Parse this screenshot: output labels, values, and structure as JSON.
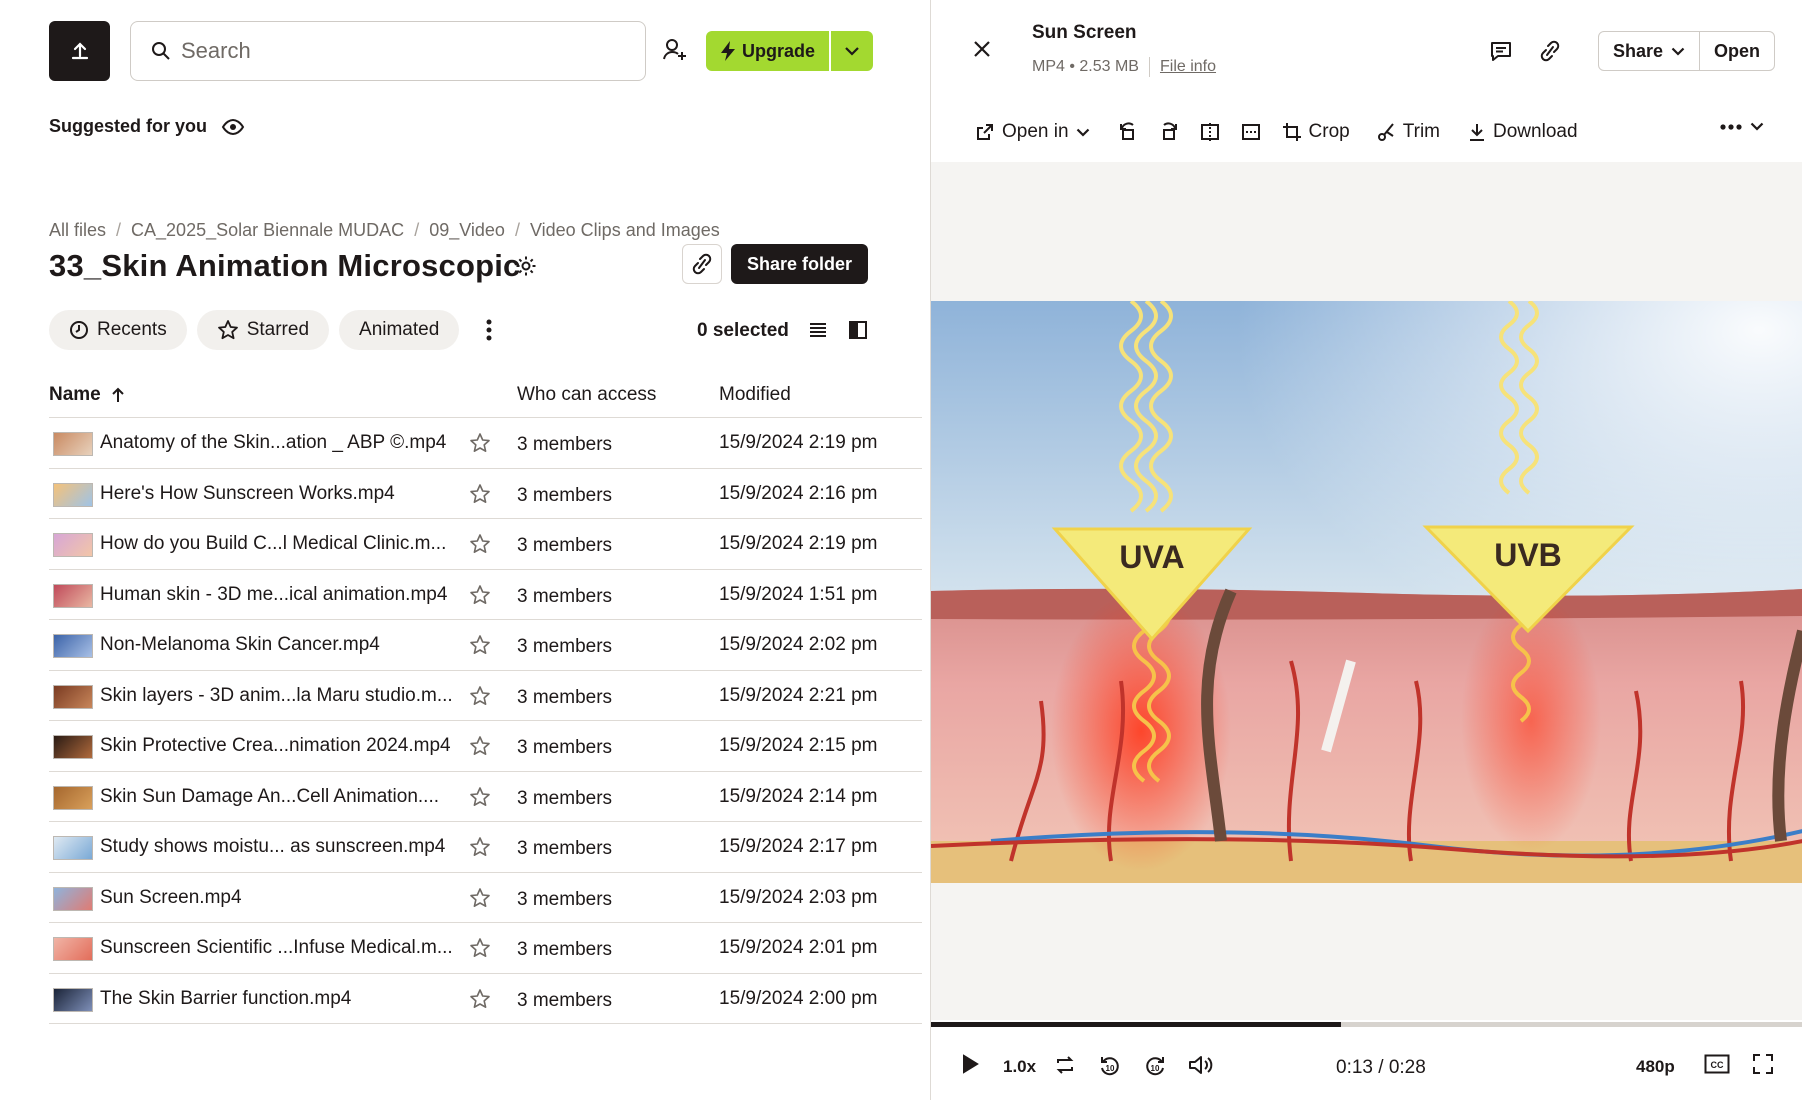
{
  "header": {
    "search_placeholder": "Search",
    "upgrade_label": "Upgrade"
  },
  "suggested_label": "Suggested for you",
  "breadcrumb": [
    "All files",
    "CA_2025_Solar Biennale MUDAC",
    "09_Video",
    "Video Clips and Images"
  ],
  "folder_title": "33_Skin Animation Microscopic",
  "share_folder_label": "Share folder",
  "filters": {
    "recents": "Recents",
    "starred": "Starred",
    "animated": "Animated"
  },
  "selected_label": "0 selected",
  "columns": {
    "name": "Name",
    "access": "Who can access",
    "modified": "Modified"
  },
  "files": [
    {
      "name": "Anatomy of the Skin...ation _ ABP ©.mp4",
      "access": "3 members",
      "modified": "15/9/2024 2:19 pm",
      "thumb": [
        "#c98a62",
        "#e8d2bd"
      ]
    },
    {
      "name": "Here's How Sunscreen Works.mp4",
      "access": "3 members",
      "modified": "15/9/2024 2:16 pm",
      "thumb": [
        "#f4c27a",
        "#9fc3e6"
      ]
    },
    {
      "name": "How do you Build C...l Medical Clinic.m...",
      "access": "3 members",
      "modified": "15/9/2024 2:19 pm",
      "thumb": [
        "#d7a6d6",
        "#f2c6a8"
      ]
    },
    {
      "name": "Human skin - 3D me...ical animation.mp4",
      "access": "3 members",
      "modified": "15/9/2024 1:51 pm",
      "thumb": [
        "#c04a5a",
        "#e9b8a3"
      ]
    },
    {
      "name": "Non-Melanoma Skin Cancer.mp4",
      "access": "3 members",
      "modified": "15/9/2024 2:02 pm",
      "thumb": [
        "#3c63a8",
        "#a8c0e6"
      ]
    },
    {
      "name": "Skin layers - 3D anim...la Maru studio.m...",
      "access": "3 members",
      "modified": "15/9/2024 2:21 pm",
      "thumb": [
        "#7a3b22",
        "#c8865a"
      ]
    },
    {
      "name": "Skin Protective Crea...nimation 2024.mp4",
      "access": "3 members",
      "modified": "15/9/2024 2:15 pm",
      "thumb": [
        "#2a1b14",
        "#b06a3c"
      ]
    },
    {
      "name": "Skin Sun Damage An...Cell Animation....",
      "access": "3 members",
      "modified": "15/9/2024 2:14 pm",
      "thumb": [
        "#a5672e",
        "#d9a05b"
      ]
    },
    {
      "name": "Study shows moistu... as sunscreen.mp4",
      "access": "3 members",
      "modified": "15/9/2024 2:17 pm",
      "thumb": [
        "#dfe9f2",
        "#7aa9d6"
      ]
    },
    {
      "name": "Sun Screen.mp4",
      "access": "3 members",
      "modified": "15/9/2024 2:03 pm",
      "thumb": [
        "#8fb3dc",
        "#e07b73"
      ]
    },
    {
      "name": "Sunscreen Scientific ...Infuse Medical.m...",
      "access": "3 members",
      "modified": "15/9/2024 2:01 pm",
      "thumb": [
        "#f0b4a6",
        "#e36d5a"
      ]
    },
    {
      "name": "The Skin Barrier function.mp4",
      "access": "3 members",
      "modified": "15/9/2024 2:00 pm",
      "thumb": [
        "#1b2438",
        "#7e8fb8"
      ]
    }
  ],
  "preview": {
    "title": "Sun Screen",
    "meta": "MP4 • 2.53 MB",
    "file_info_label": "File info",
    "share_label": "Share",
    "open_label": "Open",
    "toolbar": {
      "open_in": "Open in",
      "crop": "Crop",
      "trim": "Trim",
      "download": "Download"
    },
    "video": {
      "uva_label": "UVA",
      "uvb_label": "UVB"
    },
    "player": {
      "speed": "1.0x",
      "time": "0:13 / 0:28",
      "quality": "480p",
      "progress": 0.47
    }
  },
  "colors": {
    "accent": "#a3d930",
    "dark": "#1e1919",
    "muted": "#6f6a65"
  }
}
